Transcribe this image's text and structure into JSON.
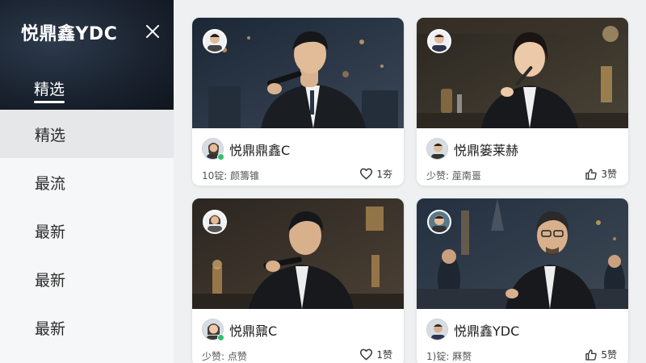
{
  "sidebar": {
    "title": "悦鼎鑫YDC",
    "header_tab": "精选",
    "close_icon": "close-icon",
    "items": [
      {
        "label": "精选",
        "active": true
      },
      {
        "label": "最流",
        "active": false
      },
      {
        "label": "最新",
        "active": false
      },
      {
        "label": "最新",
        "active": false
      },
      {
        "label": "最新",
        "active": false
      }
    ]
  },
  "cards": [
    {
      "name": "悦鼎鼎鑫C",
      "stat": "10锭: 颜籌锥",
      "likes": "1夯",
      "like_icon": "heart-icon"
    },
    {
      "name": "悦鼎篓莱赫",
      "stat": "少赞: 蓙南畺",
      "likes": "3赞",
      "like_icon": "thumbs-up-icon"
    },
    {
      "name": "悦鼎鼐C",
      "stat": "少赞: 点赞",
      "likes": "1赞",
      "like_icon": "heart-icon"
    },
    {
      "name": "悦鼎鑫YDC",
      "stat": "1)锭: 厤赘",
      "likes": "5赞",
      "like_icon": "thumbs-up-icon"
    }
  ],
  "colors": {
    "sidebar_header": "#1b2330",
    "active_item": "#e6e7e9",
    "online": "#2fbf71"
  }
}
